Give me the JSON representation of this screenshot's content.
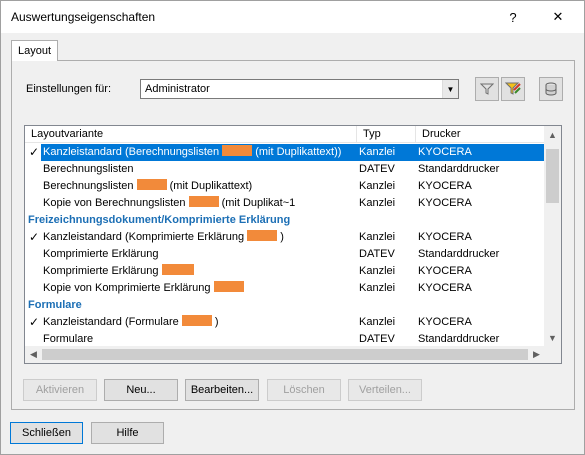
{
  "window": {
    "title": "Auswertungseigenschaften",
    "help_label": "?",
    "close_label": "✕"
  },
  "tabs": [
    {
      "label": "Layout"
    }
  ],
  "settings": {
    "label": "Einstellungen für:",
    "value": "Administrator"
  },
  "toolbar_icons": [
    "filter-icon",
    "filter-color-icon",
    "database-icon"
  ],
  "list": {
    "headers": [
      "Layoutvariante",
      "Typ",
      "Drucker"
    ],
    "rows": [
      {
        "kind": "item",
        "check": "✓",
        "name": "Kanzleistandard (Berechnungslisten",
        "redact_w": 30,
        "suffix": "(mit Duplikattext))",
        "typ": "Kanzlei",
        "drucker": "KYOCERA",
        "selected": true
      },
      {
        "kind": "item",
        "check": "",
        "name": "Berechnungslisten",
        "redact_w": 0,
        "suffix": "",
        "typ": "DATEV",
        "drucker": "Standarddrucker"
      },
      {
        "kind": "item",
        "check": "",
        "name": "Berechnungslisten",
        "redact_w": 30,
        "suffix": "(mit Duplikattext)",
        "typ": "Kanzlei",
        "drucker": "KYOCERA"
      },
      {
        "kind": "item",
        "check": "",
        "name": "Kopie von Berechnungslisten",
        "redact_w": 30,
        "suffix": "(mit Duplikat~1",
        "typ": "Kanzlei",
        "drucker": "KYOCERA"
      },
      {
        "kind": "group",
        "name": "Freizeichnungsdokument/Komprimierte Erklärung"
      },
      {
        "kind": "item",
        "check": "✓",
        "name": "Kanzleistandard (Komprimierte Erklärung",
        "redact_w": 30,
        "suffix": ")",
        "typ": "Kanzlei",
        "drucker": "KYOCERA"
      },
      {
        "kind": "item",
        "check": "",
        "name": "Komprimierte Erklärung",
        "redact_w": 0,
        "suffix": "",
        "typ": "DATEV",
        "drucker": "Standarddrucker"
      },
      {
        "kind": "item",
        "check": "",
        "name": "Komprimierte Erklärung",
        "redact_w": 32,
        "suffix": "",
        "typ": "Kanzlei",
        "drucker": "KYOCERA"
      },
      {
        "kind": "item",
        "check": "",
        "name": "Kopie von Komprimierte Erklärung",
        "redact_w": 30,
        "suffix": "",
        "typ": "Kanzlei",
        "drucker": "KYOCERA"
      },
      {
        "kind": "group",
        "name": "Formulare"
      },
      {
        "kind": "item",
        "check": "✓",
        "name": "Kanzleistandard (Formulare",
        "redact_w": 30,
        "suffix": ")",
        "typ": "Kanzlei",
        "drucker": "KYOCERA"
      },
      {
        "kind": "item",
        "check": "",
        "name": "Formulare",
        "redact_w": 0,
        "suffix": "",
        "typ": "DATEV",
        "drucker": "Standarddrucker"
      }
    ]
  },
  "buttons": {
    "aktivieren": "Aktivieren",
    "neu": "Neu...",
    "bearbeiten": "Bearbeiten...",
    "loeschen": "Löschen",
    "verteilen": "Verteilen...",
    "schliessen": "Schließen",
    "hilfe": "Hilfe"
  },
  "colors": {
    "selection": "#0078d7",
    "group_header": "#1c6fb5",
    "redaction": "#f28a3a"
  }
}
